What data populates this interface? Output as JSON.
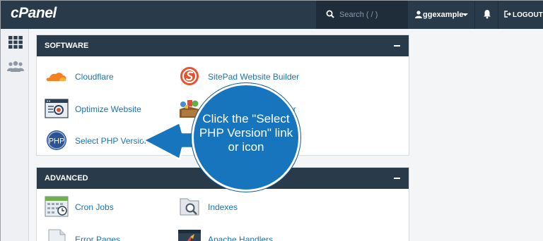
{
  "topbar": {
    "logo": "cPanel",
    "search_placeholder": "Search ( / )",
    "username": "ggexample",
    "logout_label": "LOGOUT"
  },
  "software": {
    "title": "SOFTWARE",
    "items": [
      {
        "label": "Cloudflare",
        "icon": "cloudflare-icon"
      },
      {
        "label": "SitePad Website Builder",
        "icon": "sitepad-icon"
      },
      {
        "label": "Optimize Website",
        "icon": "optimize-website-icon"
      },
      {
        "label": "er",
        "icon": "installer-icon"
      },
      {
        "label": "Select PHP Version",
        "icon": "php-icon"
      }
    ]
  },
  "advanced": {
    "title": "ADVANCED",
    "items": [
      {
        "label": "Cron Jobs",
        "icon": "cron-jobs-icon"
      },
      {
        "label": "Indexes",
        "icon": "indexes-icon"
      },
      {
        "label": "Error Pages",
        "icon": "error-pages-icon"
      },
      {
        "label": "Apache Handlers",
        "icon": "apache-handlers-icon"
      }
    ]
  },
  "callout": {
    "text": "Click the \"Select PHP Version\" link or icon",
    "color": "#1775bd"
  },
  "colors": {
    "topbar": "#293a4a",
    "link": "#1a74b8"
  }
}
